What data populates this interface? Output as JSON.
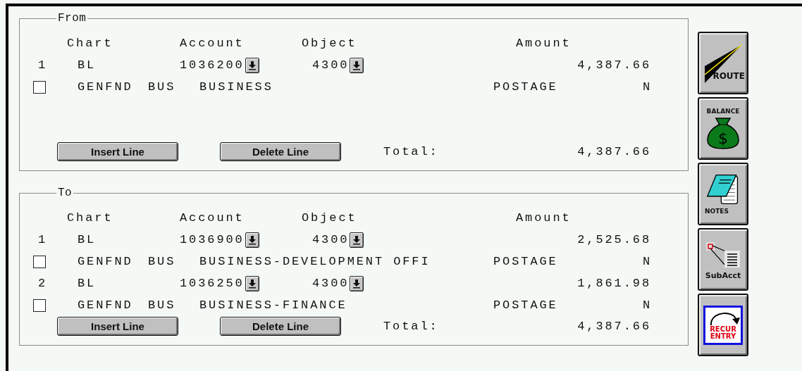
{
  "sections": [
    {
      "legend": "From",
      "headers": [
        "Chart",
        "Account",
        "Object",
        "Amount"
      ],
      "lines": [
        {
          "number": "1",
          "chart": "BL",
          "account": "1036200",
          "object": "4300",
          "amount": "4,387.66",
          "checked": false,
          "fund": "GENFND",
          "sub_fund": "BUS",
          "account_name": "BUSINESS",
          "object_name": "POSTAGE",
          "flag": "N"
        }
      ],
      "buttons": [
        "Insert Line",
        "Delete Line"
      ],
      "total_label": "Total:",
      "total": "4,387.66"
    },
    {
      "legend": "To",
      "headers": [
        "Chart",
        "Account",
        "Object",
        "Amount"
      ],
      "lines": [
        {
          "number": "1",
          "chart": "BL",
          "account": "1036900",
          "object": "4300",
          "amount": "2,525.68",
          "checked": false,
          "fund": "GENFND",
          "sub_fund": "BUS",
          "account_name": "BUSINESS-DEVELOPMENT OFFI",
          "object_name": "POSTAGE",
          "flag": "N"
        },
        {
          "number": "2",
          "chart": "BL",
          "account": "1036250",
          "object": "4300",
          "amount": "1,861.98",
          "checked": false,
          "fund": "GENFND",
          "sub_fund": "BUS",
          "account_name": "BUSINESS-FINANCE",
          "object_name": "POSTAGE",
          "flag": "N"
        }
      ],
      "buttons": [
        "Insert Line",
        "Delete Line"
      ],
      "total_label": "Total:",
      "total": "4,387.66"
    }
  ],
  "toolbar": [
    {
      "kind": "route",
      "label": "ROUTE"
    },
    {
      "kind": "balance",
      "label": "BALANCE",
      "symbol": "$"
    },
    {
      "kind": "notes",
      "label": "NOTES"
    },
    {
      "kind": "subacct",
      "label": "SubAcct"
    },
    {
      "kind": "recur",
      "label": "RECUR ENTRY"
    }
  ]
}
